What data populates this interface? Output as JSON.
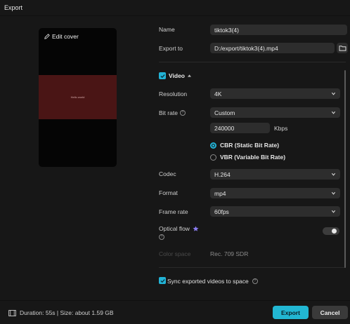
{
  "dialog": {
    "title": "Export"
  },
  "preview": {
    "edit_cover_label": "Edit cover",
    "overlay_text": "Hello world"
  },
  "name": {
    "label": "Name",
    "value": "tiktok3(4)"
  },
  "export_to": {
    "label": "Export to",
    "value": "D:/export/tiktok3(4).mp4"
  },
  "video": {
    "section_label": "Video",
    "checked": true,
    "resolution": {
      "label": "Resolution",
      "value": "4K"
    },
    "bit_rate": {
      "label": "Bit rate",
      "value": "Custom",
      "custom_value": "240000",
      "unit": "Kbps"
    },
    "rate_mode": {
      "options": [
        {
          "label": "CBR (Static Bit Rate)",
          "selected": true
        },
        {
          "label": "VBR (Variable Bit Rate)",
          "selected": false
        }
      ]
    },
    "codec": {
      "label": "Codec",
      "value": "H.264"
    },
    "format": {
      "label": "Format",
      "value": "mp4"
    },
    "frame_rate": {
      "label": "Frame rate",
      "value": "60fps"
    },
    "optical_flow": {
      "label": "Optical flow",
      "enabled": false
    },
    "color_space": {
      "label": "Color space",
      "value": "Rec. 709 SDR"
    }
  },
  "sync": {
    "label": "Sync exported videos to space",
    "checked": true
  },
  "footer": {
    "summary": "Duration: 55s | Size: about 1.59 GB",
    "export_label": "Export",
    "cancel_label": "Cancel"
  },
  "colors": {
    "accent": "#22b7d3",
    "background": "#171717",
    "field": "#2d2d2d"
  }
}
